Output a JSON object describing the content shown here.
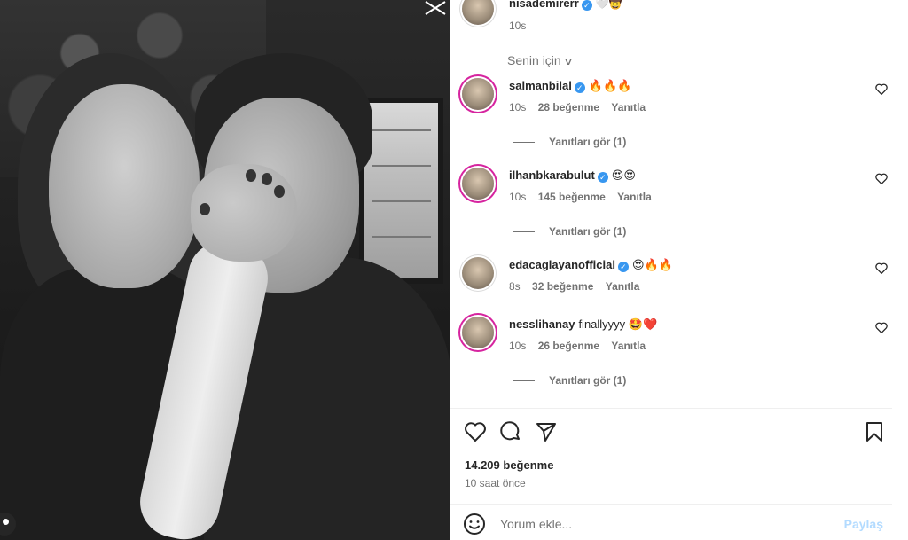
{
  "post": {
    "author": {
      "username": "nisademirerr",
      "caption_emoji": "🤍🤠",
      "time": "10s"
    },
    "sort_label": "Senin için",
    "comments": [
      {
        "username": "salmanbilal",
        "text": "🔥🔥🔥",
        "time": "10s",
        "likes": "28 beğenme",
        "reply": "Yanıtla",
        "replies": "Yanıtları gör (1)",
        "verified": true
      },
      {
        "username": "ilhanbkarabulut",
        "text": "😍😍",
        "time": "10s",
        "likes": "145 beğenme",
        "reply": "Yanıtla",
        "replies": "Yanıtları gör (1)",
        "verified": true
      },
      {
        "username": "edacaglayanofficial",
        "text": "😍🔥🔥",
        "time": "8s",
        "likes": "32 beğenme",
        "reply": "Yanıtla",
        "replies": "",
        "verified": true
      },
      {
        "username": "nesslihanay",
        "text": "finallyyyy 🤩❤️",
        "time": "10s",
        "likes": "26 beğenme",
        "reply": "Yanıtla",
        "replies": "Yanıtları gör (1)",
        "verified": false
      }
    ],
    "like_count": "14.209 beğenme",
    "posted_ago": "10 saat önce",
    "comment_input": {
      "placeholder": "Yorum ekle...",
      "post_label": "Paylaş"
    }
  },
  "icons": {
    "like": "heart-icon",
    "comment": "comment-bubble-icon",
    "share": "paper-plane-icon",
    "save": "bookmark-icon",
    "emoji": "smiley-icon",
    "verified": "verified-badge-icon"
  },
  "colors": {
    "verified": "#3897f0",
    "story_ring": "#d6249f",
    "post_button": "#b3dbff",
    "muted_text": "#737373"
  }
}
